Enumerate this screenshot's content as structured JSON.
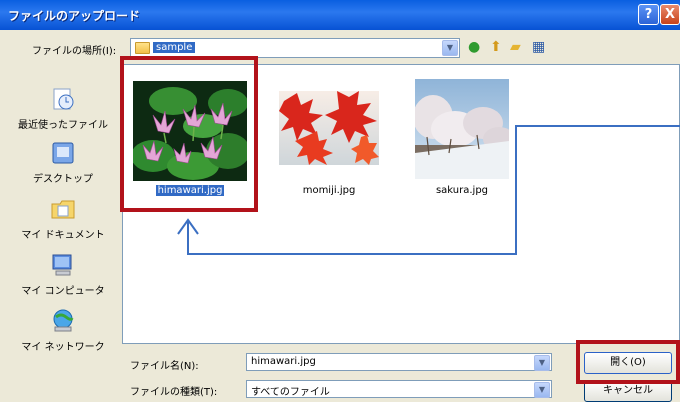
{
  "window": {
    "title": "ファイルのアップロード",
    "help_label": "?",
    "close_label": "X"
  },
  "lookin": {
    "label": "ファイルの場所(I):",
    "value": "sample"
  },
  "places": [
    {
      "label": "最近使ったファイル",
      "icon": "recent-documents-icon"
    },
    {
      "label": "デスクトップ",
      "icon": "desktop-icon"
    },
    {
      "label": "マイ ドキュメント",
      "icon": "my-documents-icon"
    },
    {
      "label": "マイ コンピュータ",
      "icon": "my-computer-icon"
    },
    {
      "label": "マイ ネットワーク",
      "icon": "my-network-icon"
    }
  ],
  "files": [
    {
      "name": "himawari.jpg",
      "selected": true
    },
    {
      "name": "momiji.jpg",
      "selected": false
    },
    {
      "name": "sakura.jpg",
      "selected": false
    }
  ],
  "filename": {
    "label": "ファイル名(N):",
    "value": "himawari.jpg"
  },
  "filetype": {
    "label": "ファイルの種類(T):",
    "value": "すべてのファイル"
  },
  "buttons": {
    "open": "開く(O)",
    "cancel": "キャンセル"
  },
  "colors": {
    "titlebar": "#0752d4",
    "annotation_red": "#b2121a",
    "annotation_arrow": "#3b6fc2",
    "selection": "#316ac5"
  }
}
